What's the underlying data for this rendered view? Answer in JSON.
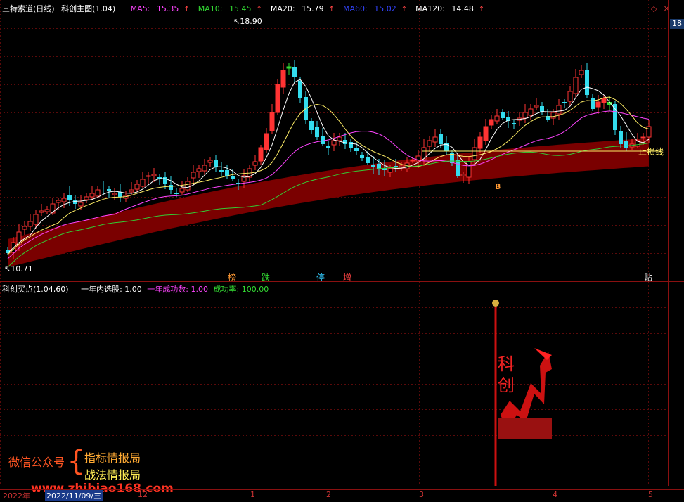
{
  "header": {
    "stock_name": "三特索道(日线)",
    "indicator_name": "科创主图(1.04)",
    "ma": [
      {
        "label": "MA5:",
        "value": "15.35",
        "color": "#ff44ff",
        "arrow": "↑"
      },
      {
        "label": "MA10:",
        "value": "15.45",
        "color": "#33dd33",
        "arrow": "↑"
      },
      {
        "label": "MA20:",
        "value": "15.79",
        "color": "#ffffff",
        "arrow": "↑"
      },
      {
        "label": "MA60:",
        "value": "15.02",
        "color": "#3344ff",
        "arrow": "↑"
      },
      {
        "label": "MA120:",
        "value": "14.48",
        "color": "#ffffff",
        "arrow": "↑"
      }
    ],
    "right_value": "18"
  },
  "main_chart": {
    "high_label": "18.90",
    "low_label": "10.71",
    "stop_loss_label": "止损线",
    "buy_marker": "B",
    "tags": [
      {
        "text": "榜",
        "color": "#ff9933"
      },
      {
        "text": "跌",
        "color": "#33dd33"
      },
      {
        "text": "停",
        "color": "#33ccff"
      },
      {
        "text": "增",
        "color": "#ff4444"
      },
      {
        "text": "贴",
        "color": "#ffffff"
      }
    ]
  },
  "sub_chart": {
    "title": "科创买点(1.04,60)",
    "stats": [
      {
        "label": "一年内选股:",
        "value": "1.00",
        "color": "#ffffff"
      },
      {
        "label": "一年成功数:",
        "value": "1.00",
        "color": "#ff44ff"
      },
      {
        "label": "成功率:",
        "value": "100.00",
        "color": "#33dd33"
      }
    ],
    "logo_text": "科创"
  },
  "watermark": {
    "line1": "微信公众号",
    "brace": "{",
    "item1": "指标情报局",
    "item2": "战法情报局",
    "url": "www.zhibiao168.com"
  },
  "x_axis": {
    "labels": [
      "2022年",
      "2022/11/09/三",
      "12",
      "1",
      "2",
      "3",
      "4",
      "5"
    ]
  },
  "chart_data": {
    "type": "candlestick",
    "title": "三特索道(日线) 科创主图(1.04)",
    "high": 18.9,
    "low": 10.71,
    "ma_latest": {
      "MA5": 15.35,
      "MA10": 15.45,
      "MA20": 15.79,
      "MA60": 15.02,
      "MA120": 14.48
    }
  }
}
